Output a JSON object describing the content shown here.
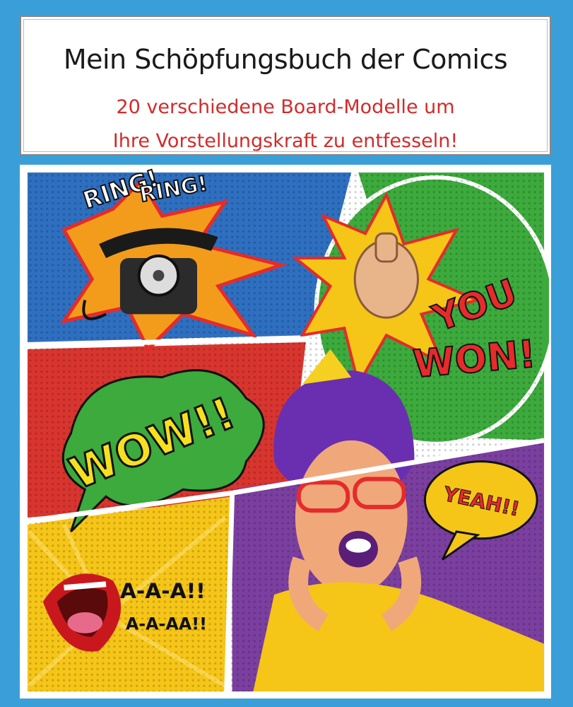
{
  "cover": {
    "title": "Mein Schöpfungsbuch der Comics",
    "subtitle_line1": "20 verschiedene Board-Modelle um",
    "subtitle_line2": "Ihre Vorstellungskraft zu entfesseln!"
  },
  "illustration": {
    "ring1": "RING!",
    "ring2": "RING!",
    "you": "YOU",
    "won": "WON!",
    "wow": "WOW!!",
    "yeah": "YEAH!!",
    "scream1": "A-A-A!!",
    "scream2": "A-A-AA!!"
  },
  "colors": {
    "background": "#3a9fd8",
    "subtitle": "#d42a2a",
    "panel_blue": "#2e6fc0",
    "panel_green": "#3caa3c",
    "panel_red": "#d8352f",
    "panel_purple": "#7b3fa0",
    "panel_yellow": "#f5c518"
  },
  "icons": [
    "telephone-icon",
    "pointing-fist-icon",
    "shouting-mouth-icon",
    "woman-illustration"
  ]
}
